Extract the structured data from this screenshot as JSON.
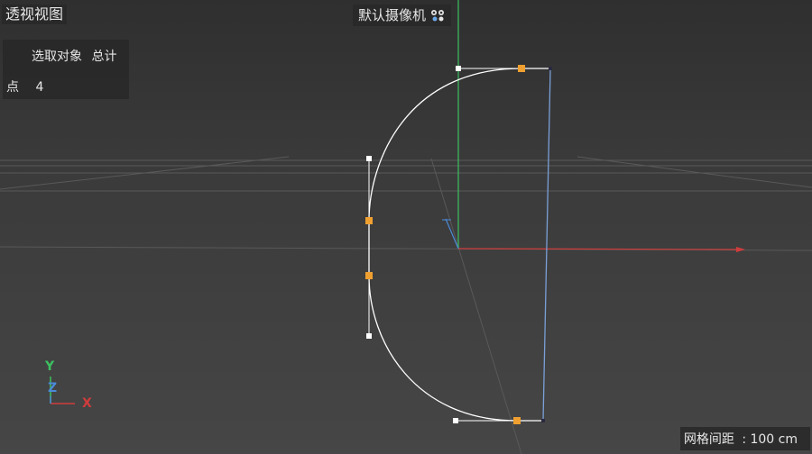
{
  "viewport": {
    "title": "透视视图",
    "camera_label": "默认摄像机",
    "camera_icon": "camera-options-icon"
  },
  "info_panel": {
    "column_selected": "选取对象",
    "column_total": "总计",
    "row_label": "点",
    "row_value": "4"
  },
  "axis_gizmo": {
    "y_label": "Y",
    "z_label": "Z",
    "x_label": "X",
    "colors": {
      "x": "#d03c3c",
      "y": "#3cc060",
      "z": "#4a8ad8"
    }
  },
  "status": {
    "grid_spacing_label": "网格间距",
    "grid_spacing_value": ": 100 cm"
  },
  "colors": {
    "spline": "#ffffff",
    "selected_point": "#f0a030",
    "axis_x": "#d03c3c",
    "axis_y": "#3cc060",
    "axis_z": "#4a8ad8",
    "grid_line": "#5a5a5a"
  }
}
